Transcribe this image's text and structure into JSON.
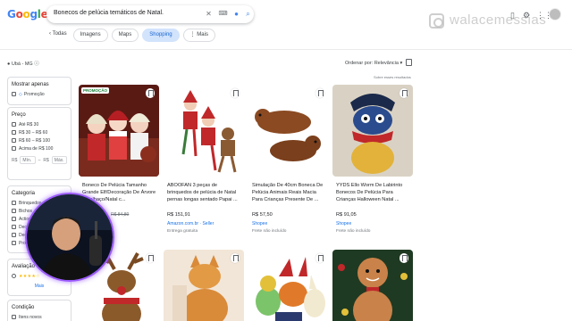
{
  "logo_text": "Google",
  "search": {
    "query": "Bonecos de pelúcia temáticos de Natal."
  },
  "tabs": [
    {
      "label": "Todas"
    },
    {
      "label": "Imagens"
    },
    {
      "label": "Maps"
    },
    {
      "label": "Shopping"
    },
    {
      "label": "Mais"
    }
  ],
  "watermark": "walacemessias",
  "location": "Ubá - MG",
  "sort": {
    "label": "Ordenar por: Relevância"
  },
  "about_results": "Sobre esses resultados",
  "sidebar": {
    "show_only": {
      "title": "Mostrar apenas",
      "items": [
        "Promoção"
      ]
    },
    "price": {
      "title": "Preço",
      "options": [
        "Até R$ 30",
        "R$ 30 – R$ 60",
        "R$ 60 – R$ 100",
        "Acima de R$ 100"
      ],
      "min_placeholder": "Mín.",
      "max_placeholder": "Máx.",
      "currency": "R$",
      "dash": "–"
    },
    "category": {
      "title": "Categoria",
      "items": [
        "Brinquedos",
        "Bichos",
        "Action",
        "Deco",
        "Deco",
        "Prom"
      ]
    },
    "rating": {
      "title": "Avaliação do produto",
      "stars": "★★★★☆",
      "more": "Mais"
    },
    "condition": {
      "title": "Condição",
      "items": [
        "Itens novos"
      ]
    }
  },
  "products": [
    {
      "badge": "PROMOÇÃO",
      "title": "Boneco De Pelúcia Tamanho Grande Elf/Decoração De Árvore ...Palhaço/Natal c...",
      "price": "R$ 84,80",
      "store": "",
      "shipping": ""
    },
    {
      "title": "ABOOFAN 3 peças de brinquedos de pelúcia de Natal pernas longas sentado Papai ...",
      "price": "R$ 151,91",
      "store": "Amazon.com.br · Seller",
      "shipping": "Entrega gratuita"
    },
    {
      "title": "Simulação De 40cm Boneca De Pelúcia Animais Reais Macia Para Crianças Presente De ...",
      "price": "R$ 57,50",
      "store": "Shopee",
      "shipping": "Frete não incluído"
    },
    {
      "title": "YYDS Ello Worm De Labirinto Bonecos De Pelúcia Para Crianças Halloween Natal ...",
      "price": "R$ 91,05",
      "store": "Shopee",
      "shipping": "Frete não incluído"
    }
  ],
  "colors": {
    "accent": "#1a73e8",
    "promo": "#188038",
    "tab_active_bg": "#d2e3fc",
    "cam_ring": "#9b59ff"
  }
}
